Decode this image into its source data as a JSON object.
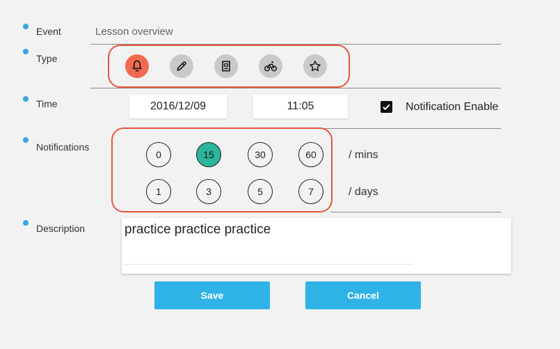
{
  "form": {
    "event": {
      "label": "Event",
      "value": "Lesson overview"
    },
    "type": {
      "label": "Type",
      "options": [
        {
          "icon": "bell-icon",
          "selected": true
        },
        {
          "icon": "pencil-icon",
          "selected": false
        },
        {
          "icon": "book-icon",
          "selected": false
        },
        {
          "icon": "bicycle-icon",
          "selected": false
        },
        {
          "icon": "star-icon",
          "selected": false
        }
      ]
    },
    "time": {
      "label": "Time",
      "date": "2016/12/09",
      "clock": "11:05",
      "notification_enable": {
        "label": "Notification Enable",
        "checked": true
      }
    },
    "notifications": {
      "label": "Notifications",
      "mins": {
        "values": [
          "0",
          "15",
          "30",
          "60"
        ],
        "unit": "/ mins",
        "selected": "15"
      },
      "days": {
        "values": [
          "1",
          "3",
          "5",
          "7"
        ],
        "unit": "/ days",
        "selected": null
      }
    },
    "description": {
      "label": "Description",
      "value": "practice practice practice"
    }
  },
  "buttons": {
    "save": "Save",
    "cancel": "Cancel"
  },
  "colors": {
    "accent": "#2fb3e6",
    "bullet": "#35a6e0",
    "highlight": "#e8553b",
    "type_active": "#f26a4f",
    "type_inactive": "#c9c9c9",
    "selected_number": "#2bb59a"
  }
}
